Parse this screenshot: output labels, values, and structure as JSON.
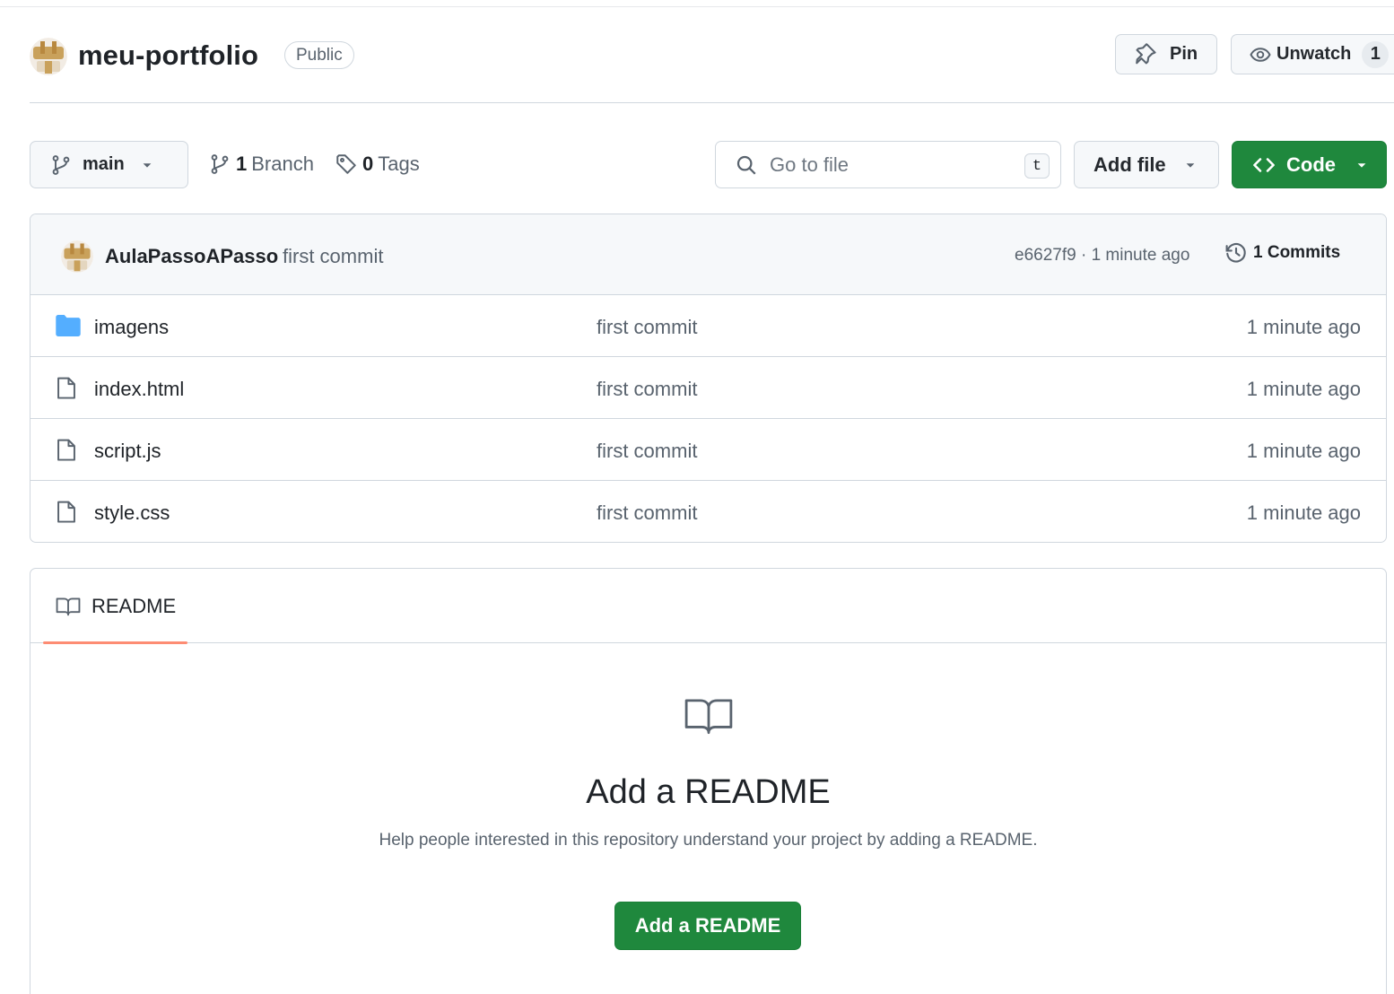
{
  "repo": {
    "name": "meu-portfolio",
    "visibility": "Public",
    "pin_label": "Pin",
    "watch_label": "Unwatch",
    "watch_count": "1"
  },
  "toolbar": {
    "branch": "main",
    "branches_count": "1",
    "branches_label": "Branch",
    "tags_count": "0",
    "tags_label": "Tags",
    "goto_placeholder": "Go to file",
    "goto_shortcut": "t",
    "add_file_label": "Add file",
    "code_label": "Code"
  },
  "latest_commit": {
    "author": "AulaPassoAPasso",
    "message": "first commit",
    "meta": "e6627f9 · 1 minute ago",
    "commits_label": "1 Commits"
  },
  "files": [
    {
      "name": "imagens",
      "type": "folder",
      "message": "first commit",
      "time": "1 minute ago"
    },
    {
      "name": "index.html",
      "type": "file",
      "message": "first commit",
      "time": "1 minute ago"
    },
    {
      "name": "script.js",
      "type": "file",
      "message": "first commit",
      "time": "1 minute ago"
    },
    {
      "name": "style.css",
      "type": "file",
      "message": "first commit",
      "time": "1 minute ago"
    }
  ],
  "readme": {
    "tab_label": "README",
    "title": "Add a README",
    "description": "Help people interested in this repository understand your project by adding a README.",
    "button_label": "Add a README"
  },
  "colors": {
    "primary_green": "#1f883d",
    "tab_underline": "#fd8c73",
    "folder_blue": "#54aeff",
    "border": "#d0d7de"
  },
  "icons": [
    "owner-avatar",
    "pin-icon",
    "eye-icon",
    "git-branch-icon",
    "tag-icon",
    "search-icon",
    "caret-down-icon",
    "code-icon",
    "history-icon",
    "folder-icon",
    "file-icon",
    "book-icon"
  ]
}
